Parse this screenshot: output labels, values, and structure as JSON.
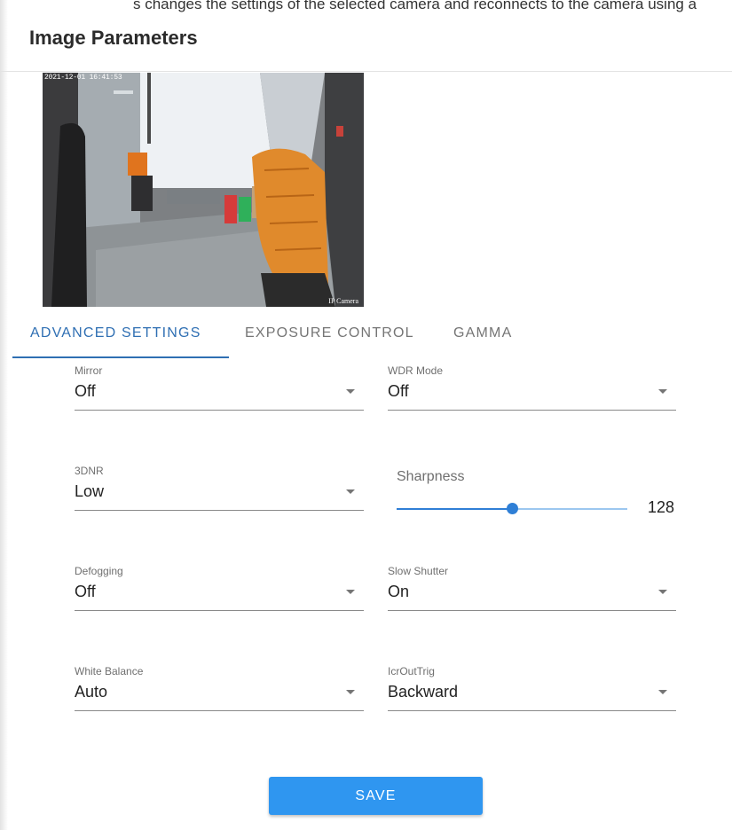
{
  "page": {
    "title": "Image Parameters",
    "top_strip_text": "s changes the settings of the  selected  camera and reconnects to the  camera using a higher le"
  },
  "preview": {
    "timestamp_overlay": "2021-12-01 16:41:53",
    "camera_label": "IP Camera"
  },
  "tabs": [
    {
      "label": "ADVANCED SETTINGS",
      "active": true
    },
    {
      "label": "EXPOSURE CONTROL",
      "active": false
    },
    {
      "label": "GAMMA",
      "active": false
    }
  ],
  "fields": {
    "mirror": {
      "label": "Mirror",
      "value": "Off"
    },
    "wdr_mode": {
      "label": "WDR Mode",
      "value": "Off"
    },
    "dnr": {
      "label": "3DNR",
      "value": "Low"
    },
    "defogging": {
      "label": "Defogging",
      "value": "Off"
    },
    "slow_shutter": {
      "label": "Slow Shutter",
      "value": "On"
    },
    "white_balance": {
      "label": "White Balance",
      "value": "Auto"
    },
    "icr_out_trig": {
      "label": "IcrOutTrig",
      "value": "Backward"
    }
  },
  "sharpness": {
    "label": "Sharpness",
    "value": "128",
    "fraction": 0.5
  },
  "actions": {
    "save_label": "SAVE"
  },
  "colors": {
    "accent": "#2f6fb3",
    "save_button": "#2f96f0",
    "slider": "#2f7fd6"
  }
}
